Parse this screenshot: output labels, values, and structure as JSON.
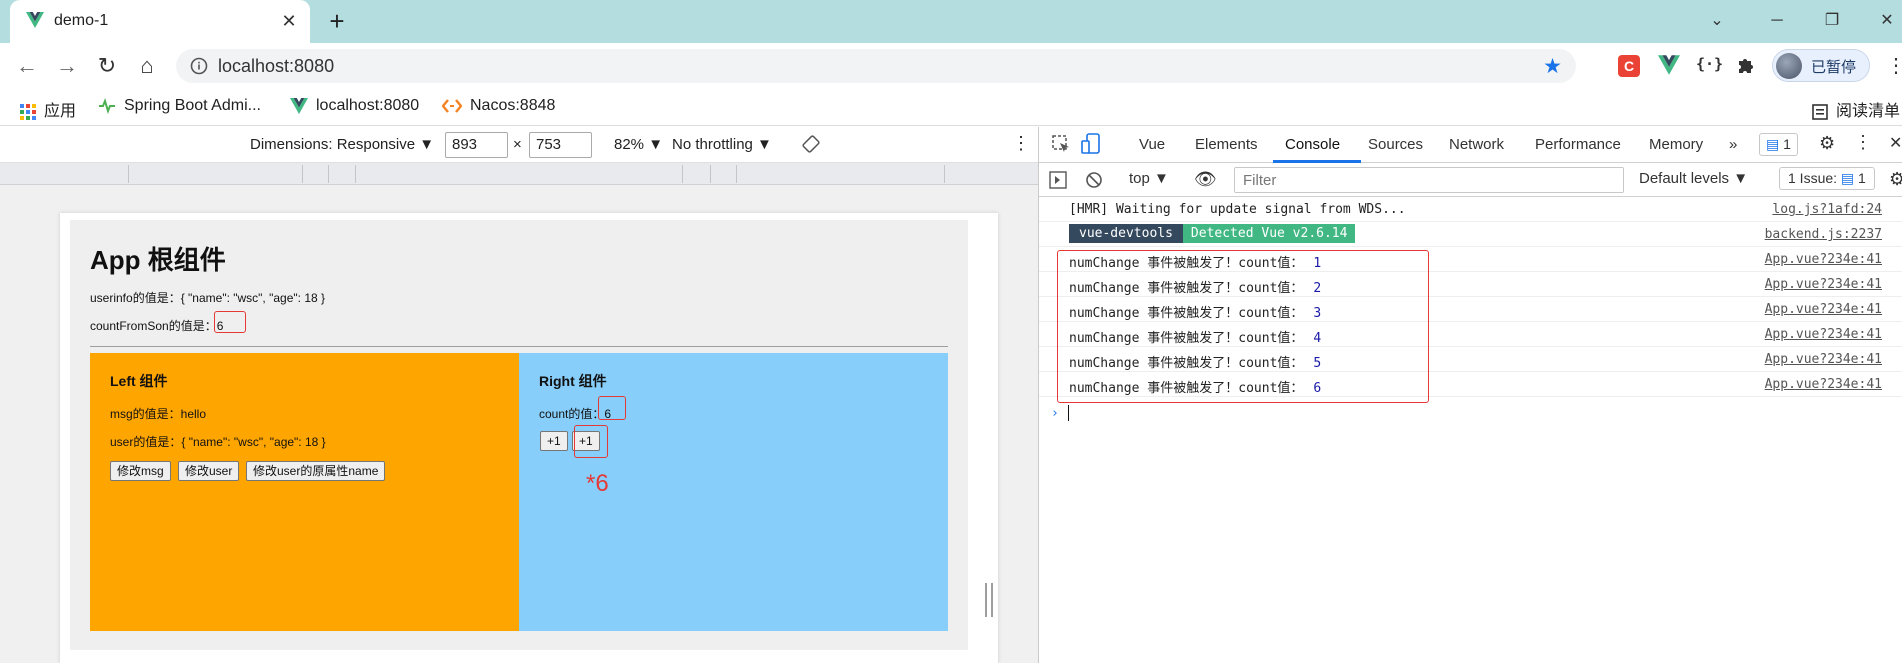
{
  "tab": {
    "title": "demo-1",
    "close": "✕",
    "new_tab": "+"
  },
  "window": {
    "menu": "⌄",
    "minimize": "─",
    "maximize": "❐",
    "close": "✕"
  },
  "toolbar": {
    "back": "←",
    "forward": "→",
    "reload": "↻",
    "home": "⌂",
    "url": "localhost:8080",
    "profile_label": "已暂停",
    "menu": "⋮"
  },
  "bookmarks": [
    {
      "label": "应用",
      "icon": "apps-grid-icon"
    },
    {
      "label": "Spring Boot Admi...",
      "icon": "spring-boot-admin-icon"
    },
    {
      "label": "localhost:8080",
      "icon": "vue-logo-icon"
    },
    {
      "label": "Nacos:8848",
      "icon": "nacos-icon"
    },
    {
      "label": "阅读清单",
      "icon": "reading-list-icon"
    }
  ],
  "device_toolbar": {
    "dimensions_label": "Dimensions: Responsive ▼",
    "width": "893",
    "times": "×",
    "height": "753",
    "zoom": "82% ▼",
    "throttling": "No throttling ▼",
    "more": "⋮"
  },
  "app": {
    "title": "App 根组件",
    "userinfo_label": "userinfo的值是：",
    "userinfo_value": "{ \"name\": \"wsc\", \"age\": 18 }",
    "count_from_son_label": "countFromSon的值是：",
    "count_from_son_value": "6",
    "left": {
      "title": "Left 组件",
      "msg_label": "msg的值是：",
      "msg_value": "hello",
      "user_label": "user的值是：",
      "user_value": "{ \"name\": \"wsc\", \"age\": 18 }",
      "buttons": [
        "修改msg",
        "修改user",
        "修改user的原属性name"
      ]
    },
    "right": {
      "title": "Right 组件",
      "count_label": "count的值：",
      "count_value": "6",
      "buttons": [
        "+1",
        "+1"
      ]
    },
    "annotation": "*6"
  },
  "devtools": {
    "tabs": [
      "Vue",
      "Elements",
      "Console",
      "Sources",
      "Network",
      "Performance",
      "Memory"
    ],
    "active_tab": "Console",
    "more_tabs": "»",
    "issues_badge": "1",
    "context": "top ▼",
    "filter_placeholder": "Filter",
    "default_levels": "Default levels ▼",
    "issues_label": "1 Issue:",
    "issues_count": "1"
  },
  "console": {
    "hmr": {
      "message": "[HMR] Waiting for update signal from WDS...",
      "source": "log.js?1afd:24"
    },
    "devtools_badge": {
      "left": "vue-devtools",
      "right": "Detected Vue v2.6.14",
      "source": "backend.js:2237"
    },
    "logs": [
      {
        "message": "numChange 事件被触发了！count值：",
        "value": "1",
        "source": "App.vue?234e:41"
      },
      {
        "message": "numChange 事件被触发了！count值：",
        "value": "2",
        "source": "App.vue?234e:41"
      },
      {
        "message": "numChange 事件被触发了！count值：",
        "value": "3",
        "source": "App.vue?234e:41"
      },
      {
        "message": "numChange 事件被触发了！count值：",
        "value": "4",
        "source": "App.vue?234e:41"
      },
      {
        "message": "numChange 事件被触发了！count值：",
        "value": "5",
        "source": "App.vue?234e:41"
      },
      {
        "message": "numChange 事件被触发了！count值：",
        "value": "6",
        "source": "App.vue?234e:41"
      }
    ],
    "prompt": "›"
  },
  "colors": {
    "tabstrip": "#b4dde0",
    "left_panel": "#ffa500",
    "right_panel": "#87cefa",
    "annotation_red": "#e53935",
    "vue_green": "#41b883",
    "vue_dark": "#35495e",
    "accent_blue": "#1a73e8"
  }
}
